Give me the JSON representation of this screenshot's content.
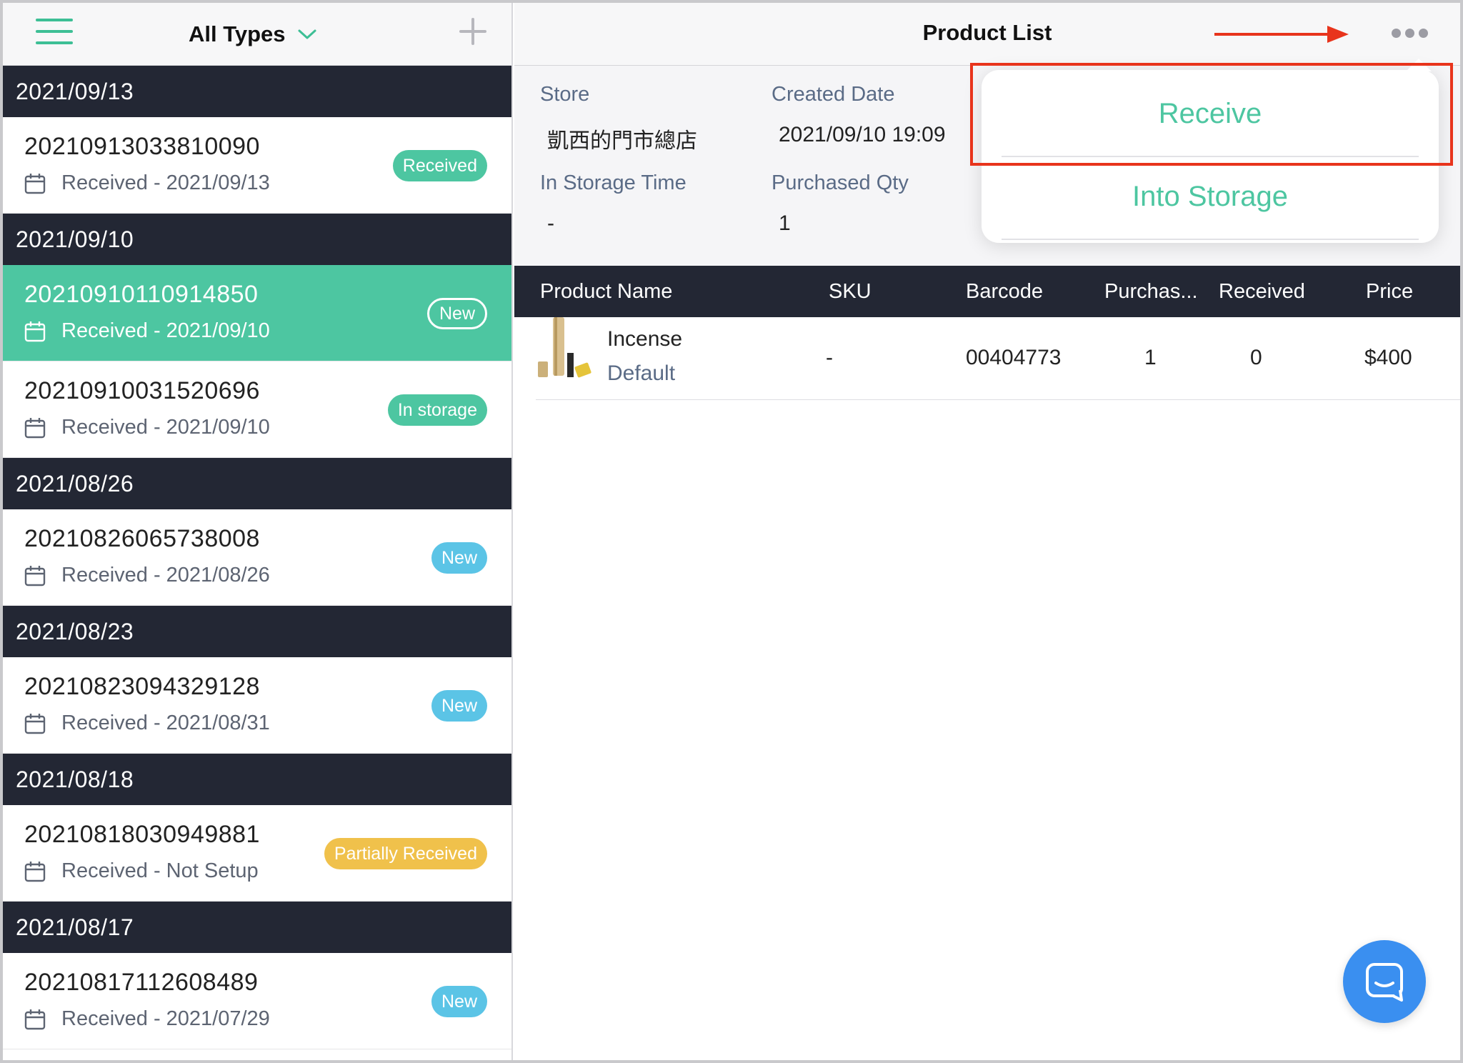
{
  "left_header": {
    "filter_label": "All Types"
  },
  "orders": [
    {
      "date": "2021/09/13",
      "items": [
        {
          "number": "20210913033810090",
          "received": "Received - 2021/09/13",
          "status": "Received",
          "style": "received"
        }
      ]
    },
    {
      "date": "2021/09/10",
      "items": [
        {
          "number": "20210910110914850",
          "received": "Received - 2021/09/10",
          "status": "New",
          "style": "new-outline",
          "selected": true
        },
        {
          "number": "20210910031520696",
          "received": "Received - 2021/09/10",
          "status": "In storage",
          "style": "instorage"
        }
      ]
    },
    {
      "date": "2021/08/26",
      "items": [
        {
          "number": "20210826065738008",
          "received": "Received - 2021/08/26",
          "status": "New",
          "style": "new"
        }
      ]
    },
    {
      "date": "2021/08/23",
      "items": [
        {
          "number": "20210823094329128",
          "received": "Received - 2021/08/31",
          "status": "New",
          "style": "new"
        }
      ]
    },
    {
      "date": "2021/08/18",
      "items": [
        {
          "number": "20210818030949881",
          "received": "Received - Not Setup",
          "status": "Partially Received",
          "style": "partial"
        }
      ]
    },
    {
      "date": "2021/08/17",
      "items": [
        {
          "number": "20210817112608489",
          "received": "Received - 2021/07/29",
          "status": "New",
          "style": "new"
        }
      ]
    }
  ],
  "right_header": {
    "title": "Product List"
  },
  "info": {
    "store_label": "Store",
    "store_value": "凱西的門市總店",
    "created_label": "Created Date",
    "created_value": "2021/09/10 19:09",
    "storage_label": "In Storage Time",
    "storage_value": "-",
    "qty_label": "Purchased Qty",
    "qty_value": "1"
  },
  "table": {
    "columns": [
      "Product Name",
      "SKU",
      "Barcode",
      "Purchas...",
      "Received",
      "Price"
    ],
    "rows": [
      {
        "name": "Incense",
        "variant": "Default",
        "sku": "-",
        "barcode": "00404773",
        "purchased": "1",
        "received": "0",
        "price": "$400"
      }
    ]
  },
  "popover": {
    "receive_label": "Receive",
    "into_storage_label": "Into Storage"
  },
  "colors": {
    "accent": "#4dc6a1",
    "dark_header": "#232734",
    "badge_new": "#5bc4e6",
    "badge_partial": "#f0c14b",
    "annotation_red": "#e8341c",
    "chat_button": "#3a8ff0"
  },
  "icons": [
    "hamburger-icon",
    "chevron-down-icon",
    "plus-icon",
    "calendar-icon",
    "more-icon",
    "arrow-annotation",
    "chat-icon"
  ]
}
